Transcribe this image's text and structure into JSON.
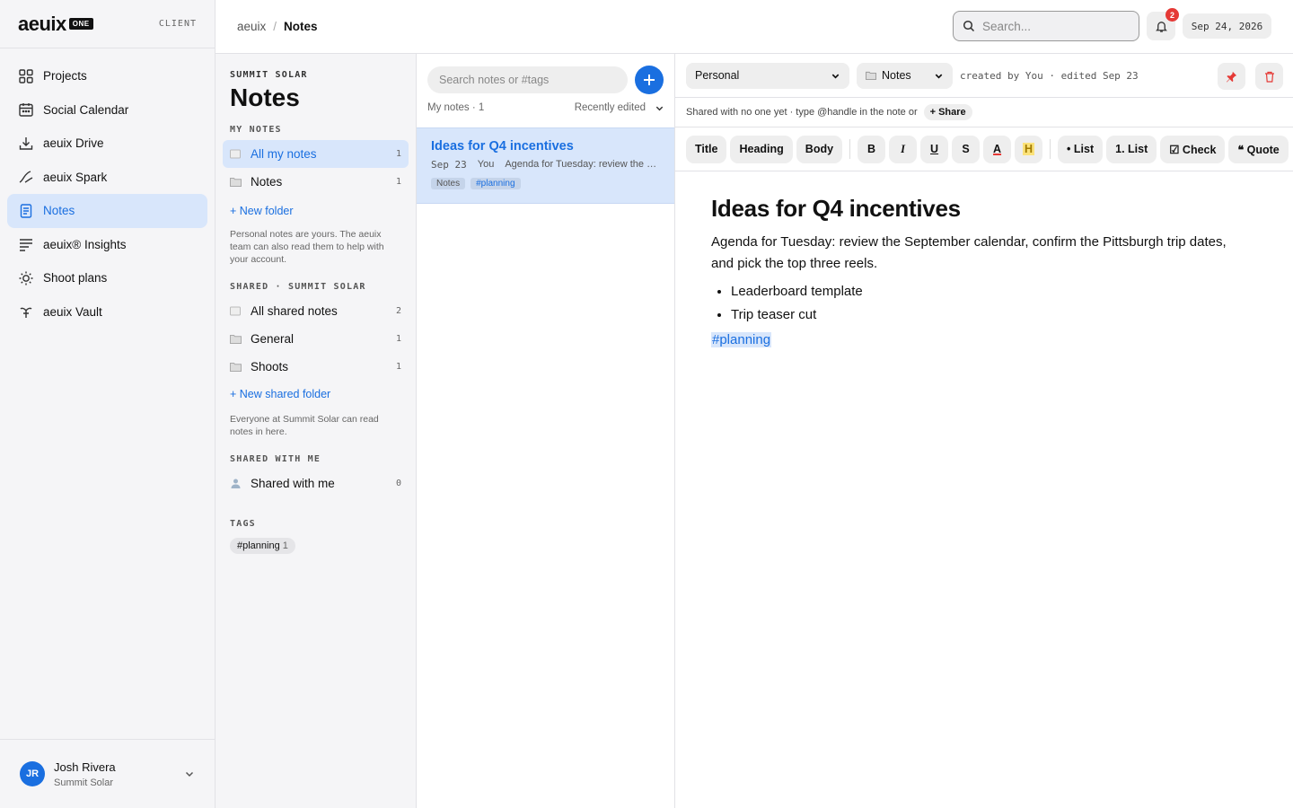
{
  "brand": {
    "logo": "aeuix",
    "logo_badge": "ONE",
    "role": "CLIENT"
  },
  "nav": {
    "items": [
      {
        "label": "Projects",
        "icon": "grid-icon"
      },
      {
        "label": "Social Calendar",
        "icon": "calendar-icon"
      },
      {
        "label": "aeuix Drive",
        "icon": "download-icon"
      },
      {
        "label": "aeuix Spark",
        "icon": "spark-icon"
      },
      {
        "label": "Notes",
        "icon": "notes-icon",
        "active": true
      },
      {
        "label": "aeuix® Insights",
        "icon": "insights-icon"
      },
      {
        "label": "Shoot plans",
        "icon": "sun-icon"
      },
      {
        "label": "aeuix Vault",
        "icon": "vault-icon"
      }
    ]
  },
  "user": {
    "initials": "JR",
    "name": "Josh Rivera",
    "org": "Summit Solar"
  },
  "topbar": {
    "breadcrumb": {
      "root": "aeuix",
      "sep": "/",
      "current": "Notes"
    },
    "search_placeholder": "Search...",
    "notifications": "2",
    "date": "Sep 24, 2026"
  },
  "folders": {
    "workspace": "SUMMIT SOLAR",
    "title": "Notes",
    "my_notes": {
      "heading": "MY NOTES",
      "items": [
        {
          "label": "All my notes",
          "count": "1"
        },
        {
          "label": "Notes",
          "count": "1"
        }
      ],
      "new_label": "+ New folder",
      "note": "Personal notes are yours. The aeuix team can also read them to help with your account."
    },
    "shared": {
      "heading": "SHARED · SUMMIT SOLAR",
      "items": [
        {
          "label": "All shared notes",
          "count": "2"
        },
        {
          "label": "General",
          "count": "1"
        },
        {
          "label": "Shoots",
          "count": "1"
        }
      ],
      "new_label": "+ New shared folder",
      "note": "Everyone at Summit Solar can read notes in here."
    },
    "shared_with_me": {
      "heading": "SHARED WITH ME",
      "item": {
        "label": "Shared with me",
        "count": "0"
      }
    },
    "tags": {
      "heading": "TAGS",
      "items": [
        {
          "label": "#planning",
          "count": "1"
        }
      ]
    }
  },
  "list": {
    "search_placeholder": "Search notes or #tags",
    "meta": "My notes · 1",
    "sort": "Recently edited",
    "notes": [
      {
        "title": "Ideas for Q4 incentives",
        "date": "Sep 23",
        "author": "You",
        "snippet": "Agenda for Tuesday: review the September calendar, confirm the Pittsburgh trip dates, and pick the top three reels.",
        "tags": [
          "Notes",
          "#planning"
        ]
      }
    ]
  },
  "editor": {
    "scope": "Personal",
    "folder": "Notes",
    "meta": "created by You · edited Sep 23",
    "share_text": "Shared with  no one yet · type @handle in the note or",
    "share_button": "+ Share",
    "toolbar": {
      "title": "Title",
      "heading": "Heading",
      "body": "Body",
      "bold": "B",
      "italic": "I",
      "underline": "U",
      "strike": "S",
      "color": "A",
      "highlight": "H",
      "bullet": "• List",
      "numbered": "1. List",
      "check": "☑ Check",
      "quote": "❝ Quote"
    },
    "doc": {
      "title": "Ideas for Q4 incentives",
      "body": "Agenda for Tuesday: review the September calendar, confirm the Pittsburgh trip dates, and pick the top three reels.",
      "bullets": [
        "Leaderboard template",
        "Trip teaser cut"
      ],
      "tag": "#planning"
    }
  },
  "colors": {
    "accent": "#1a6fe0",
    "active_bg": "#d8e6fb",
    "badge": "#e53935"
  }
}
